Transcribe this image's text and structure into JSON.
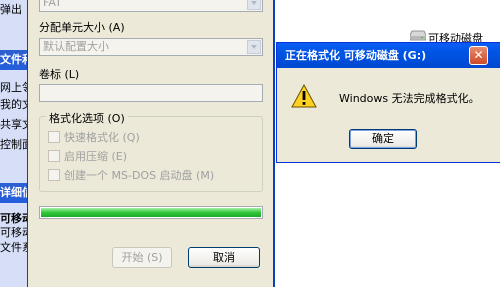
{
  "taskpane": {
    "heading_top": "弹出",
    "heading1": "文件和文件夹位置",
    "items1": [
      "网上邻居",
      "我的文档",
      "共享文档",
      "控制面板"
    ],
    "heading2": "详细信息",
    "details": [
      "可移动磁盘",
      "可移动磁盘",
      "文件系统"
    ]
  },
  "format_dialog": {
    "filesystem_value": "FAT",
    "alloc_label": "分配单元大小 (A)",
    "alloc_value": "默认配置大小",
    "volume_label": "卷标 (L)",
    "volume_value": "",
    "options_legend": "格式化选项 (O)",
    "options": [
      "快速格式化 (Q)",
      "启用压缩 (E)",
      "创建一个 MS-DOS 启动盘 (M)"
    ],
    "progress": 1.0,
    "start_button": "开始 (S)",
    "cancel_button": "取消"
  },
  "desktop": {
    "disk_label": "可移动磁盘"
  },
  "message_box": {
    "title": "正在格式化 可移动磁盘 (G:)",
    "close_glyph": "✕",
    "message": "Windows 无法完成格式化。",
    "ok_button": "确定"
  },
  "colors": {
    "titlebar": "#0054e3",
    "progress_green": "#2fc83a",
    "dialog_bg": "#ece9d8"
  }
}
